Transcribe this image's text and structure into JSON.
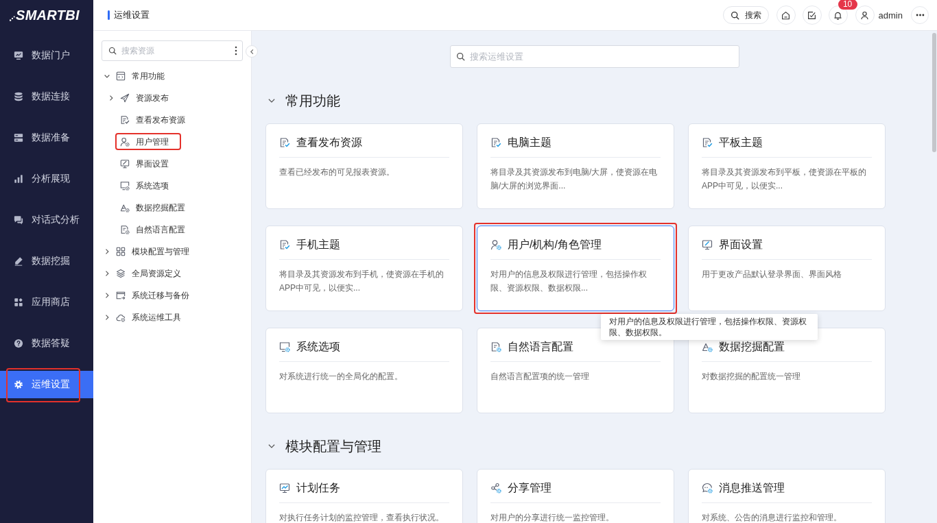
{
  "sidebar": {
    "logo": "SMARTBI",
    "items": [
      {
        "label": "数据门户",
        "kind": "portal",
        "selected": false,
        "annotated": false
      },
      {
        "label": "数据连接",
        "kind": "connect",
        "selected": false,
        "annotated": false
      },
      {
        "label": "数据准备",
        "kind": "prepare",
        "selected": false,
        "annotated": false
      },
      {
        "label": "分析展现",
        "kind": "analysis",
        "selected": false,
        "annotated": false
      },
      {
        "label": "对话式分析",
        "kind": "dialog",
        "selected": false,
        "annotated": false
      },
      {
        "label": "数据挖掘",
        "kind": "mining",
        "selected": false,
        "annotated": false
      },
      {
        "label": "应用商店",
        "kind": "store",
        "selected": false,
        "annotated": false
      },
      {
        "label": "数据答疑",
        "kind": "qa",
        "selected": false,
        "annotated": false
      },
      {
        "label": "运维设置",
        "kind": "settings",
        "selected": true,
        "annotated": true
      }
    ]
  },
  "header": {
    "title": "运维设置",
    "search_label": "搜索",
    "notification_count": "10",
    "user": "admin"
  },
  "tree": {
    "search": {
      "placeholder": "搜索资源"
    },
    "nodes": [
      {
        "label": "常用功能",
        "kind": "common",
        "expanded": true,
        "annotated": false,
        "children": [
          {
            "label": "资源发布",
            "kind": "publish",
            "expanded": false,
            "annotated": false
          },
          {
            "label": "查看发布资源",
            "kind": "document",
            "annotated": false
          },
          {
            "label": "用户管理",
            "kind": "user",
            "annotated": true
          },
          {
            "label": "界面设置",
            "kind": "display",
            "annotated": false
          },
          {
            "label": "系统选项",
            "kind": "system",
            "annotated": false
          },
          {
            "label": "数据挖掘配置",
            "kind": "mining",
            "annotated": false
          },
          {
            "label": "自然语言配置",
            "kind": "language",
            "annotated": false
          }
        ]
      },
      {
        "label": "模块配置与管理",
        "kind": "module",
        "expanded": false,
        "annotated": false
      },
      {
        "label": "全局资源定义",
        "kind": "global",
        "expanded": false,
        "annotated": false
      },
      {
        "label": "系统迁移与备份",
        "kind": "migration",
        "expanded": false,
        "annotated": false
      },
      {
        "label": "系统运维工具",
        "kind": "tools",
        "expanded": false,
        "annotated": false
      }
    ]
  },
  "main": {
    "search": {
      "placeholder": "搜索运维设置"
    },
    "sections": [
      {
        "title": "常用功能",
        "expanded": true,
        "cards": [
          {
            "title": "查看发布资源",
            "kind": "document",
            "description": "查看已经发布的可见报表资源。",
            "hovered": false,
            "annotated": false
          },
          {
            "title": "电脑主题",
            "kind": "document",
            "description": "将目录及其资源发布到电脑/大屏，使资源在电脑/大屏的浏览界面...",
            "hovered": false,
            "annotated": false
          },
          {
            "title": "平板主题",
            "kind": "document",
            "description": "将目录及其资源发布到平板，使资源在平板的APP中可见，以便实...",
            "hovered": false,
            "annotated": false
          },
          {
            "title": "手机主题",
            "kind": "document",
            "description": "将目录及其资源发布到手机，使资源在手机的APP中可见，以便实...",
            "hovered": false,
            "annotated": false
          },
          {
            "title": "用户/机构/角色管理",
            "kind": "user",
            "description": "对用户的信息及权限进行管理，包括操作权限、资源权限、数据权限...",
            "hovered": true,
            "annotated": true,
            "tooltip": "对用户的信息及权限进行管理，包括操作权限、资源权限、数据权限。"
          },
          {
            "title": "界面设置",
            "kind": "display",
            "description": "用于更改产品默认登录界面、界面风格",
            "hovered": false,
            "annotated": false
          },
          {
            "title": "系统选项",
            "kind": "system",
            "description": "对系统进行统一的全局化的配置。",
            "hovered": false,
            "annotated": false
          },
          {
            "title": "自然语言配置",
            "kind": "language",
            "description": "自然语言配置项的统一管理",
            "hovered": false,
            "annotated": false
          },
          {
            "title": "数据挖掘配置",
            "kind": "mining",
            "description": "对数据挖掘的配置统一管理",
            "hovered": false,
            "annotated": false
          }
        ]
      },
      {
        "title": "模块配置与管理",
        "expanded": true,
        "cards": [
          {
            "title": "计划任务",
            "kind": "schedule",
            "description": "对执行任务计划的监控管理，查看执行状况。",
            "hovered": false,
            "annotated": false
          },
          {
            "title": "分享管理",
            "kind": "share",
            "description": "对用户的分享进行统一监控管理。",
            "hovered": false,
            "annotated": false
          },
          {
            "title": "消息推送管理",
            "kind": "message",
            "description": "对系统、公告的消息进行监控和管理。",
            "hovered": false,
            "annotated": false
          }
        ]
      }
    ]
  }
}
